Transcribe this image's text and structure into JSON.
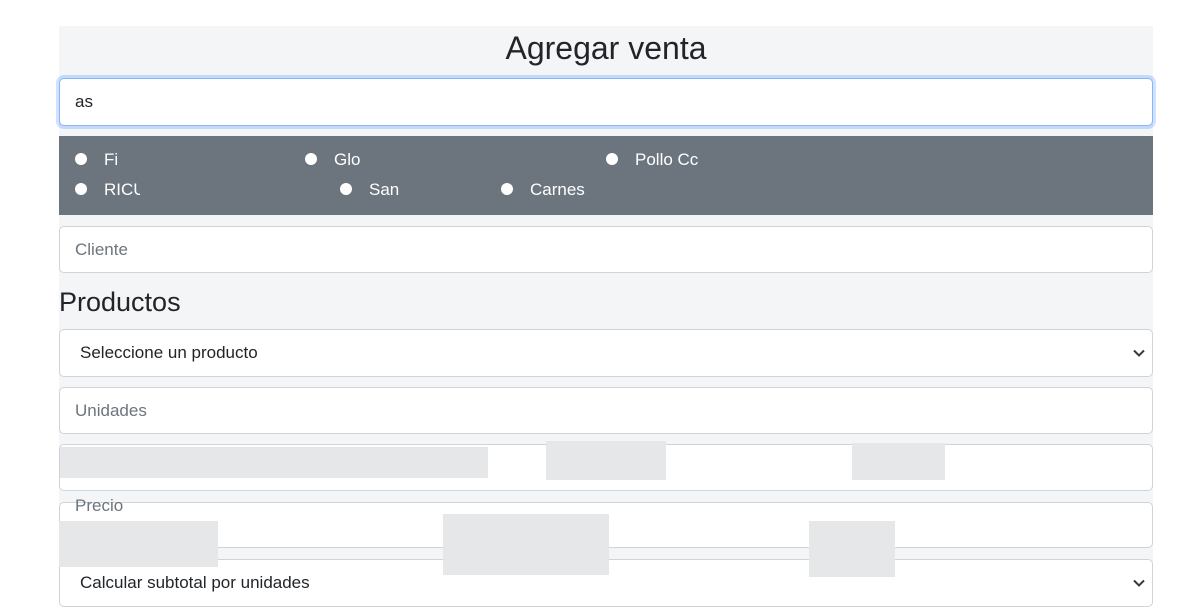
{
  "form": {
    "title": "Agregar venta",
    "search_value": "as",
    "results": [
      {
        "label": "Fi"
      },
      {
        "label": "Glo"
      },
      {
        "label": "Pollo Cc"
      },
      {
        "label": "RICU"
      },
      {
        "label": "San"
      },
      {
        "label": "Carnes"
      }
    ],
    "client_placeholder": "Cliente",
    "products_heading": "Productos",
    "product_select": "Seleccione un producto",
    "units_placeholder": "Unidades",
    "partial_field_text": "Precio",
    "subtotal_select": "Calcular subtotal por unidades"
  },
  "colors": {
    "results_bg": "#6c757d",
    "focus_border": "#86b7fe",
    "panel_bg": "#f4f5f7"
  }
}
